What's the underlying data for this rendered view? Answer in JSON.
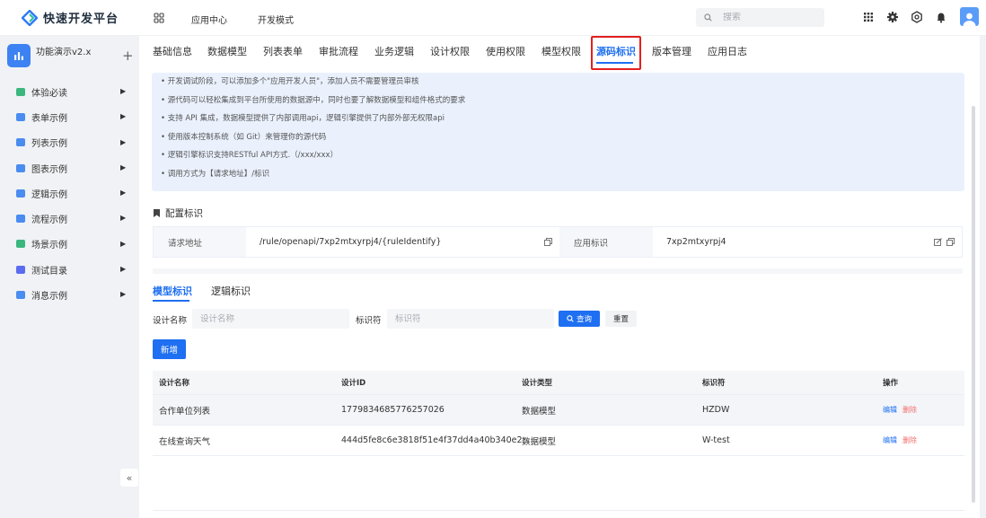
{
  "topbar": {
    "logo_text": "快速开发平台",
    "nav": [
      "应用中心",
      "开发模式"
    ],
    "search_placeholder": "搜索"
  },
  "sidebar": {
    "app_name": "功能演示v2.x",
    "items": [
      {
        "label": "体验必读",
        "color": "#3bb77e"
      },
      {
        "label": "表单示例",
        "color": "#4a8cf0"
      },
      {
        "label": "列表示例",
        "color": "#4a8cf0"
      },
      {
        "label": "图表示例",
        "color": "#4a8cf0"
      },
      {
        "label": "逻辑示例",
        "color": "#4a8cf0"
      },
      {
        "label": "流程示例",
        "color": "#4a8cf0"
      },
      {
        "label": "场景示例",
        "color": "#3bb77e"
      },
      {
        "label": "测试目录",
        "color": "#5b6cf0"
      },
      {
        "label": "消息示例",
        "color": "#4a8cf0"
      }
    ],
    "collapse": "«"
  },
  "tabs": [
    "基础信息",
    "数据模型",
    "列表表单",
    "审批流程",
    "业务逻辑",
    "设计权限",
    "使用权限",
    "模型权限",
    "源码标识",
    "版本管理",
    "应用日志"
  ],
  "active_tab": "源码标识",
  "info_lines": [
    "• 开发调试阶段，可以添加多个\"应用开发人员\"，添加人员不需要管理员审核",
    "• 源代码可以轻松集成到平台所使用的数据源中，同时也要了解数据模型和组件格式的要求",
    "• 支持 API 集成，数据模型提供了内部调用api，逻辑引擎提供了内部外部无权限api",
    "• 使用版本控制系统（如 Git）来管理你的源代码",
    "• 逻辑引擎标识支持RESTful API方式.（/xxx/xxx）",
    "• 调用方式为【请求地址】/标识"
  ],
  "config": {
    "title": "配置标识",
    "request_label": "请求地址",
    "request_value": "/rule/openapi/7xp2mtxyrpj4/{ruleIdentify}",
    "app_label": "应用标识",
    "app_value": "7xp2mtxyrpj4"
  },
  "subtabs": [
    "模型标识",
    "逻辑标识"
  ],
  "filters": {
    "name_label": "设计名称",
    "name_placeholder": "设计名称",
    "id_label": "标识符",
    "id_placeholder": "标识符",
    "query": "查询",
    "reset": "重置",
    "new": "新增"
  },
  "table": {
    "headers": [
      "设计名称",
      "设计ID",
      "设计类型",
      "标识符",
      "操作"
    ],
    "rows": [
      {
        "name": "合作单位列表",
        "id": "1779834685776257026",
        "type": "数据模型",
        "code": "HZDW",
        "edit": "编辑",
        "del": "删除"
      },
      {
        "name": "在线查询天气",
        "id": "444d5fe8c6e3818f51e4f37dd4a40b340e2...",
        "type": "数据模型",
        "code": "W-test",
        "edit": "编辑",
        "del": "删除"
      }
    ]
  }
}
